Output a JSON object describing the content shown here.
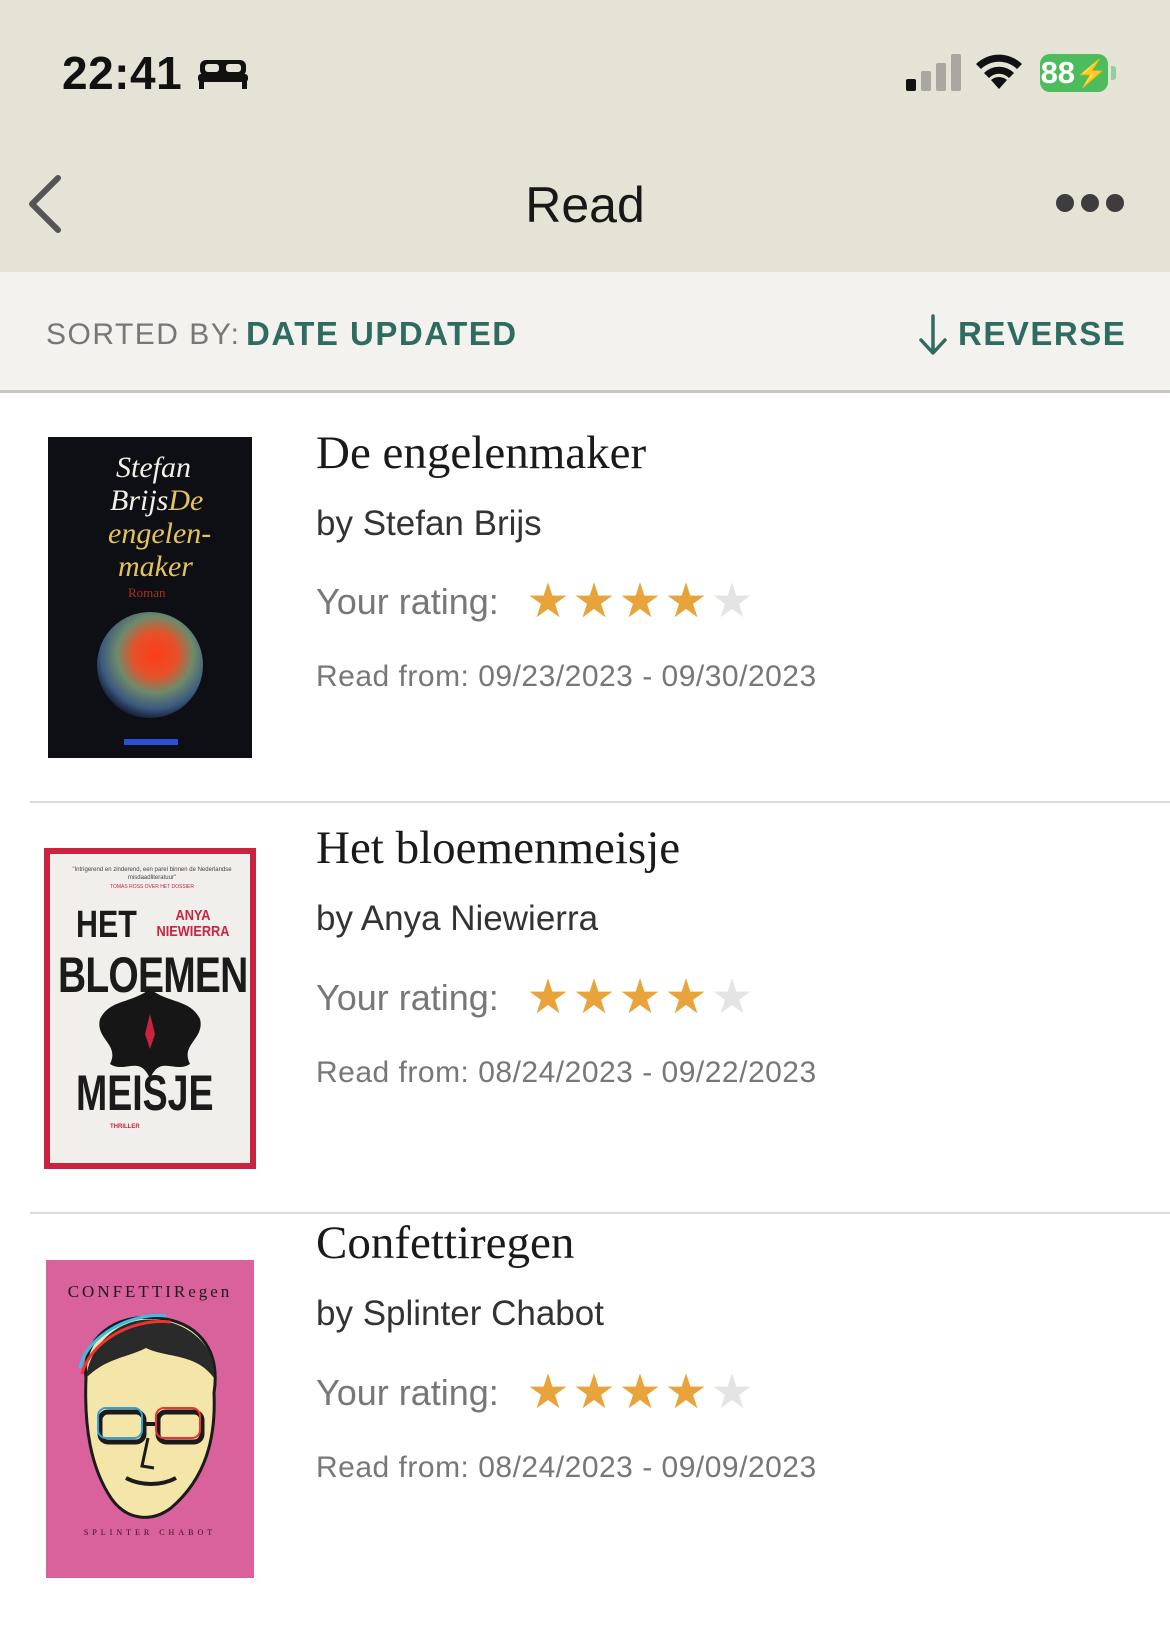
{
  "status_bar": {
    "time": "22:41",
    "battery": "88"
  },
  "nav": {
    "title": "Read"
  },
  "sort": {
    "label": "SORTED BY:",
    "value": "DATE UPDATED",
    "reverse_label": "REVERSE"
  },
  "colors": {
    "accent": "#2e6b60",
    "star_filled": "#e8a43a",
    "star_empty": "#e4e4e4",
    "header_bg": "#e5e2d6"
  },
  "books": [
    {
      "title": "De engelenmaker",
      "author": "by Stefan Brijs",
      "rating_label": "Your rating:",
      "rating": 4,
      "max_rating": 5,
      "dates": "Read from: 09/23/2023 - 09/30/2023",
      "cover": {
        "line1": "Stefan",
        "line2": "Brijs",
        "line3": "De",
        "line4": "engelen-",
        "line5": "maker",
        "line6": "Roman"
      }
    },
    {
      "title": "Het bloemenmeisje",
      "author": "by Anya Niewierra",
      "rating_label": "Your rating:",
      "rating": 4,
      "max_rating": 5,
      "dates": "Read from: 08/24/2023 - 09/22/2023",
      "cover": {
        "quote": "\"Intrigerend en zinderend, een parel binnen de Nederlandse misdaadliteratuur\"",
        "quote_source": "TOMAS ROSS OVER HET DOSSIER",
        "word1": "HET",
        "author1": "ANYA",
        "author2": "NIEWIERRA",
        "word2": "BLOEMEN",
        "word3": "MEISJE",
        "genre": "THRILLER"
      }
    },
    {
      "title": "Confettiregen",
      "author": "by Splinter Chabot",
      "rating_label": "Your rating:",
      "rating": 4,
      "max_rating": 5,
      "dates": "Read from: 08/24/2023 - 09/09/2023",
      "cover": {
        "title": "CONFETTIRegen",
        "author": "SPLINTER CHABOT"
      }
    }
  ]
}
